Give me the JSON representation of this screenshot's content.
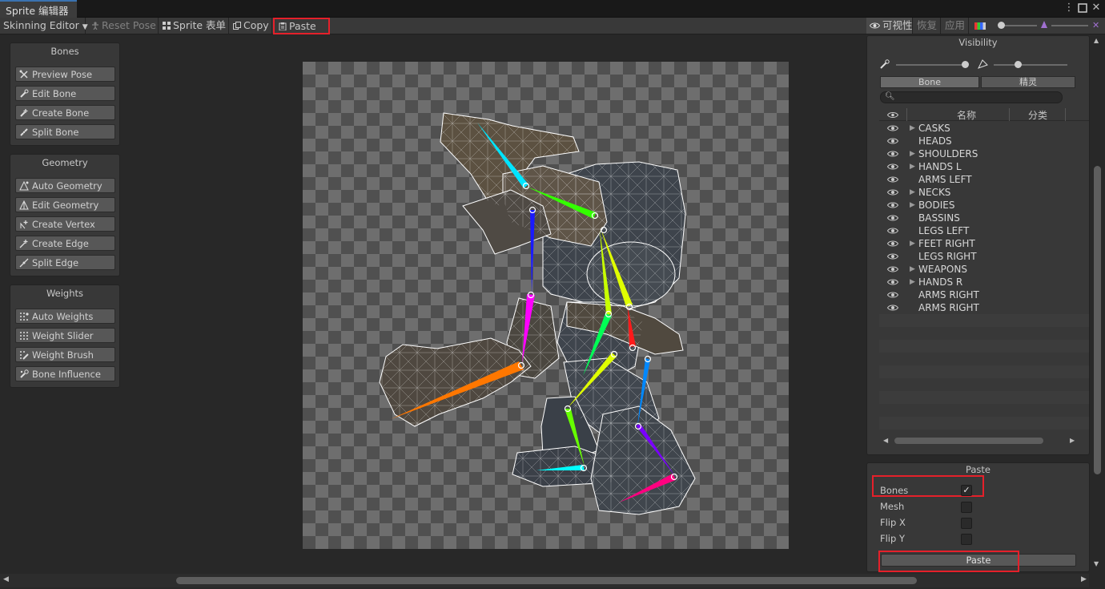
{
  "window": {
    "tab_title": "Sprite 编辑器"
  },
  "toolbar": {
    "mode_dropdown": "Skinning Editor",
    "reset_pose": "Reset Pose",
    "sprite_sheet": "Sprite 表单",
    "copy": "Copy",
    "paste": "Paste",
    "visibility_toggle": "可视性",
    "revert": "恢复",
    "apply": "应用"
  },
  "tool_panels": {
    "bones": {
      "title": "Bones",
      "buttons": [
        "Preview Pose",
        "Edit Bone",
        "Create Bone",
        "Split Bone"
      ]
    },
    "geometry": {
      "title": "Geometry",
      "buttons": [
        "Auto Geometry",
        "Edit Geometry",
        "Create Vertex",
        "Create Edge",
        "Split Edge"
      ]
    },
    "weights": {
      "title": "Weights",
      "buttons": [
        "Auto Weights",
        "Weight Slider",
        "Weight Brush",
        "Bone Influence"
      ]
    }
  },
  "visibility_panel": {
    "title": "Visibility",
    "tabs": [
      "Bone",
      "精灵"
    ],
    "selected_tab": "Bone",
    "search_placeholder": "",
    "columns": [
      "名称",
      "分类"
    ],
    "rows": [
      {
        "name": "CASKS",
        "expandable": true
      },
      {
        "name": "HEADS",
        "expandable": false
      },
      {
        "name": "SHOULDERS",
        "expandable": true
      },
      {
        "name": "HANDS L",
        "expandable": true
      },
      {
        "name": "ARMS LEFT",
        "expandable": false
      },
      {
        "name": "NECKS",
        "expandable": true
      },
      {
        "name": "BODIES",
        "expandable": true
      },
      {
        "name": "BASSINS",
        "expandable": false
      },
      {
        "name": "LEGS LEFT",
        "expandable": false
      },
      {
        "name": "FEET RIGHT",
        "expandable": true
      },
      {
        "name": "LEGS RIGHT",
        "expandable": false
      },
      {
        "name": "WEAPONS",
        "expandable": true
      },
      {
        "name": "HANDS R",
        "expandable": true
      },
      {
        "name": "ARMS RIGHT",
        "expandable": false
      },
      {
        "name": "ARMS RIGHT",
        "expandable": false
      }
    ]
  },
  "paste_panel": {
    "title": "Paste",
    "options": [
      {
        "label": "Bones",
        "checked": true
      },
      {
        "label": "Mesh",
        "checked": false
      },
      {
        "label": "Flip X",
        "checked": false
      },
      {
        "label": "Flip Y",
        "checked": false
      }
    ],
    "paste_button": "Paste"
  },
  "colors": {
    "highlight_box": "#e5202a",
    "bone_colors": [
      "#00e5ff",
      "#1a1aff",
      "#33ff00",
      "#c8ff00",
      "#ff00ff",
      "#ff7700",
      "#00ff55",
      "#ff1a1a",
      "#e0ff00",
      "#0088ff",
      "#66ff00",
      "#00ffff",
      "#7a00ff",
      "#ff0080"
    ]
  }
}
